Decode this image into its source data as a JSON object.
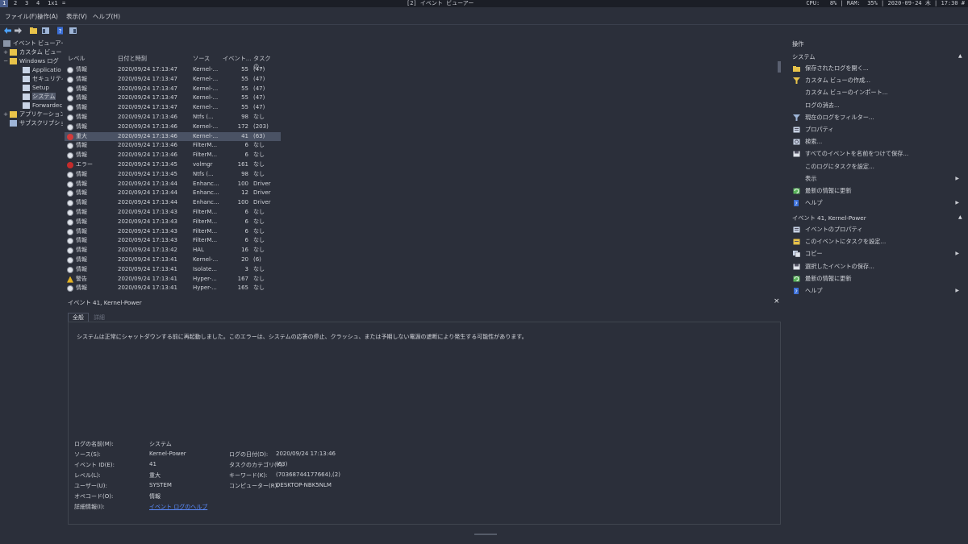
{
  "topbar": {
    "workspaces": [
      "1",
      "2",
      "3",
      "4",
      "1x1",
      "="
    ],
    "window_title": "[2] イベント ビューアー",
    "stats": "CPU:   8% | RAM:  35% | 2020-09-24 木 | 17:30 #"
  },
  "menu": {
    "file": "ファイル(F)",
    "action": "操作(A)",
    "view": "表示(V)",
    "help": "ヘルプ(H)"
  },
  "tree": {
    "root": "イベント ビューアー (ロ",
    "custom_views": "カスタム ビュー",
    "windows_logs": "Windows ログ",
    "application": "Applicatio",
    "security": "セキュリティ",
    "setup": "Setup",
    "system": "システム",
    "forwarded": "Forwardec",
    "apps_services": "アプリケーションとサ",
    "subscriptions": "サブスクリプション"
  },
  "list": {
    "columns": [
      "レベル",
      "日付と時刻",
      "ソース",
      "イベント...",
      "タスクの..."
    ],
    "rows": [
      {
        "level": "情報",
        "type": "info",
        "date": "2020/09/24 17:13:47",
        "source": "Kernel-...",
        "id": "55",
        "task": "(47)"
      },
      {
        "level": "情報",
        "type": "info",
        "date": "2020/09/24 17:13:47",
        "source": "Kernel-...",
        "id": "55",
        "task": "(47)"
      },
      {
        "level": "情報",
        "type": "info",
        "date": "2020/09/24 17:13:47",
        "source": "Kernel-...",
        "id": "55",
        "task": "(47)"
      },
      {
        "level": "情報",
        "type": "info",
        "date": "2020/09/24 17:13:47",
        "source": "Kernel-...",
        "id": "55",
        "task": "(47)"
      },
      {
        "level": "情報",
        "type": "info",
        "date": "2020/09/24 17:13:47",
        "source": "Kernel-...",
        "id": "55",
        "task": "(47)"
      },
      {
        "level": "情報",
        "type": "info",
        "date": "2020/09/24 17:13:46",
        "source": "Ntfs (...",
        "id": "98",
        "task": "なし"
      },
      {
        "level": "情報",
        "type": "info",
        "date": "2020/09/24 17:13:46",
        "source": "Kernel-...",
        "id": "172",
        "task": "(203)"
      },
      {
        "level": "重大",
        "type": "critical",
        "date": "2020/09/24 17:13:46",
        "source": "Kernel-...",
        "id": "41",
        "task": "(63)"
      },
      {
        "level": "情報",
        "type": "info",
        "date": "2020/09/24 17:13:46",
        "source": "FilterM...",
        "id": "6",
        "task": "なし"
      },
      {
        "level": "情報",
        "type": "info",
        "date": "2020/09/24 17:13:46",
        "source": "FilterM...",
        "id": "6",
        "task": "なし"
      },
      {
        "level": "エラー",
        "type": "error",
        "date": "2020/09/24 17:13:45",
        "source": "volmgr",
        "id": "161",
        "task": "なし"
      },
      {
        "level": "情報",
        "type": "info",
        "date": "2020/09/24 17:13:45",
        "source": "Ntfs (...",
        "id": "98",
        "task": "なし"
      },
      {
        "level": "情報",
        "type": "info",
        "date": "2020/09/24 17:13:44",
        "source": "Enhanc...",
        "id": "100",
        "task": "Driver"
      },
      {
        "level": "情報",
        "type": "info",
        "date": "2020/09/24 17:13:44",
        "source": "Enhanc...",
        "id": "12",
        "task": "Driver"
      },
      {
        "level": "情報",
        "type": "info",
        "date": "2020/09/24 17:13:44",
        "source": "Enhanc...",
        "id": "100",
        "task": "Driver"
      },
      {
        "level": "情報",
        "type": "info",
        "date": "2020/09/24 17:13:43",
        "source": "FilterM...",
        "id": "6",
        "task": "なし"
      },
      {
        "level": "情報",
        "type": "info",
        "date": "2020/09/24 17:13:43",
        "source": "FilterM...",
        "id": "6",
        "task": "なし"
      },
      {
        "level": "情報",
        "type": "info",
        "date": "2020/09/24 17:13:43",
        "source": "FilterM...",
        "id": "6",
        "task": "なし"
      },
      {
        "level": "情報",
        "type": "info",
        "date": "2020/09/24 17:13:43",
        "source": "FilterM...",
        "id": "6",
        "task": "なし"
      },
      {
        "level": "情報",
        "type": "info",
        "date": "2020/09/24 17:13:42",
        "source": "HAL",
        "id": "16",
        "task": "なし"
      },
      {
        "level": "情報",
        "type": "info",
        "date": "2020/09/24 17:13:41",
        "source": "Kernel-...",
        "id": "20",
        "task": "(6)"
      },
      {
        "level": "情報",
        "type": "info",
        "date": "2020/09/24 17:13:41",
        "source": "Isolate...",
        "id": "3",
        "task": "なし"
      },
      {
        "level": "警告",
        "type": "warning",
        "date": "2020/09/24 17:13:41",
        "source": "Hyper-...",
        "id": "167",
        "task": "なし"
      },
      {
        "level": "情報",
        "type": "info",
        "date": "2020/09/24 17:13:41",
        "source": "Hyper-...",
        "id": "165",
        "task": "なし"
      }
    ]
  },
  "detail": {
    "title": "イベント 41, Kernel-Power",
    "tab_general": "全般",
    "tab_details": "詳細",
    "description": "システムは正常にシャットダウンする前に再起動しました。このエラーは、システムの応答の停止、クラッシュ、または予期しない電源の遮断により発生する可能性があります。",
    "fields": {
      "log_name_label": "ログの名前(M):",
      "log_name": "システム",
      "source_label": "ソース(S):",
      "source": "Kernel-Power",
      "logged_label": "ログの日付(D):",
      "logged": "2020/09/24 17:13:46",
      "event_id_label": "イベント ID(E):",
      "event_id": "41",
      "task_category_label": "タスクのカテゴリ(Y):",
      "task_category": "(63)",
      "level_label": "レベル(L):",
      "level": "重大",
      "keywords_label": "キーワード(K):",
      "keywords": "(70368744177664),(2)",
      "user_label": "ユーザー(U):",
      "user": "SYSTEM",
      "computer_label": "コンピューター(R):",
      "computer": "DESKTOP-NBK5NLM",
      "opcode_label": "オペコード(O):",
      "opcode": "情報",
      "more_info_label": "詳細情報(I):",
      "more_info": "イベント ログのヘルプ"
    }
  },
  "actions": {
    "header": "操作",
    "section1": "システム",
    "items1": [
      {
        "label": "保存されたログを開く...",
        "icon": "folder-open-icon"
      },
      {
        "label": "カスタム ビューの作成...",
        "icon": "filter-create-icon"
      },
      {
        "label": "カスタム ビューのインポート...",
        "icon": ""
      },
      {
        "label": "ログの消去...",
        "icon": ""
      },
      {
        "label": "現在のログをフィルター...",
        "icon": "filter-icon"
      },
      {
        "label": "プロパティ",
        "icon": "properties-icon"
      },
      {
        "label": "検索...",
        "icon": "find-icon"
      },
      {
        "label": "すべてのイベントを名前をつけて保存...",
        "icon": "save-icon"
      },
      {
        "label": "このログにタスクを設定...",
        "icon": ""
      },
      {
        "label": "表示",
        "icon": "",
        "arrow": "▶"
      },
      {
        "label": "最新の情報に更新",
        "icon": "refresh-icon"
      },
      {
        "label": "ヘルプ",
        "icon": "help-icon",
        "arrow": "▶"
      }
    ],
    "section2": "イベント 41, Kernel-Power",
    "items2": [
      {
        "label": "イベントのプロパティ",
        "icon": "properties-icon"
      },
      {
        "label": "このイベントにタスクを設定...",
        "icon": "task-icon"
      },
      {
        "label": "コピー",
        "icon": "copy-icon",
        "arrow": "▶"
      },
      {
        "label": "選択したイベントの保存...",
        "icon": "save-icon"
      },
      {
        "label": "最新の情報に更新",
        "icon": "refresh-icon"
      },
      {
        "label": "ヘルプ",
        "icon": "help-icon",
        "arrow": "▶"
      }
    ]
  },
  "colors": {
    "info": "#dfe3ea",
    "critical": "#d23b3b",
    "error": "#c42b2b",
    "warning": "#e6b422",
    "link": "#5b8cff",
    "selection": "#4a5264"
  }
}
